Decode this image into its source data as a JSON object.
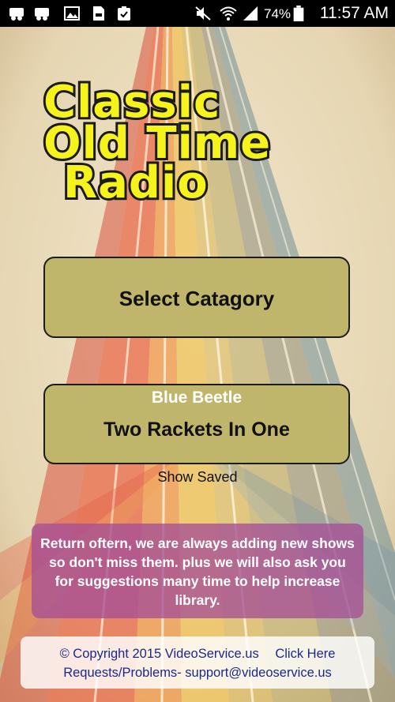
{
  "status_bar": {
    "notification_icons": [
      "steam-icon",
      "steam-icon",
      "image-icon",
      "sd-card-icon",
      "clipboard-check-icon"
    ],
    "system_icons": [
      "mute-icon",
      "wifi-icon",
      "cellular-signal-icon",
      "battery-icon"
    ],
    "battery_percent": "74%",
    "time": "11:57 AM"
  },
  "logo": {
    "line1": "Classic",
    "line2": "Old Time",
    "line3": "Radio",
    "colors": {
      "fill": "#f5f31b",
      "stroke": "#1b1b1b"
    }
  },
  "select_category": {
    "label": "Select Catagory"
  },
  "saved_show": {
    "series": "Blue Beetle",
    "title": "Two Rackets In One",
    "caption": "Show Saved"
  },
  "message": "Return oftern, we are always adding new shows so don't miss them. plus we will also ask you for suggestions many time to help increase library.",
  "footer": {
    "copyright": "© Copyright 2015 VideoService.us",
    "click_here": "Click Here",
    "requests_prefix": "Requests/Problems-",
    "support_email": "support@videoservice.us"
  },
  "colors": {
    "button_bg": "#bfb56b",
    "message_bg": "#a55096",
    "footer_text": "#1a2a8c",
    "background": "#e9dcc0"
  }
}
